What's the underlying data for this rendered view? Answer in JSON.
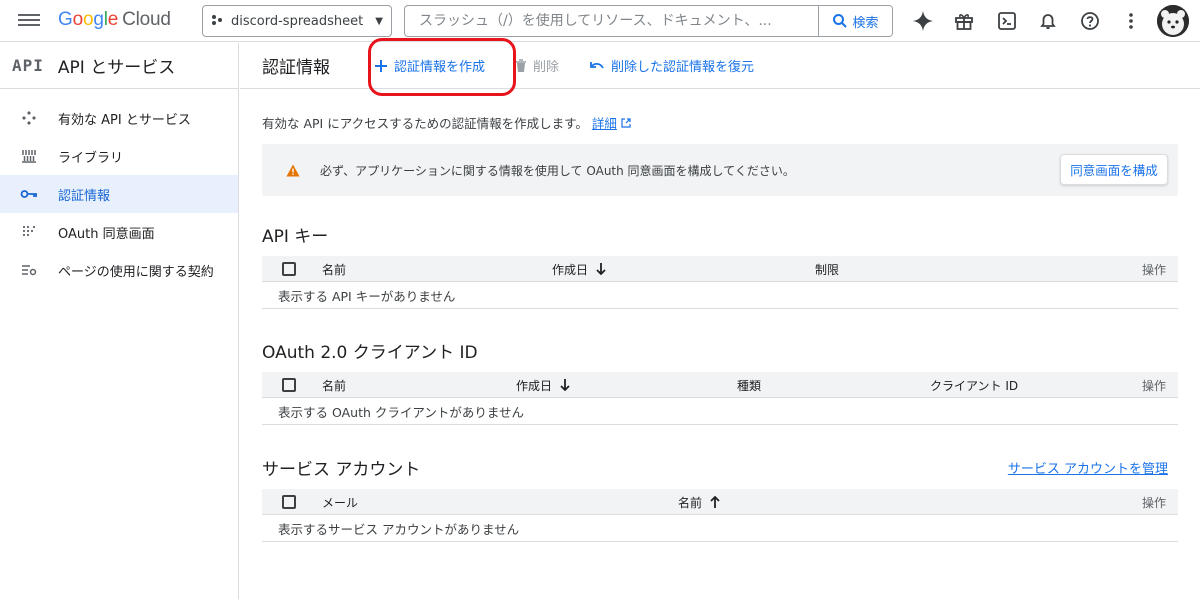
{
  "topbar": {
    "logo_letters": [
      "G",
      "o",
      "o",
      "g",
      "l",
      "e"
    ],
    "logo_cloud": "Cloud",
    "project_name": "discord-spreadsheet",
    "search_placeholder": "スラッシュ（/）を使用してリソース、ドキュメント、...",
    "search_button": "検索",
    "icons": [
      "gemini-icon",
      "gift-icon",
      "cloud-shell-icon",
      "bell-icon",
      "help-icon",
      "more-vert-icon"
    ]
  },
  "sidebar": {
    "badge": "API",
    "title": "API とサービス",
    "items": [
      {
        "label": "有効な API とサービス",
        "icon": "api-icon"
      },
      {
        "label": "ライブラリ",
        "icon": "library-icon"
      },
      {
        "label": "認証情報",
        "icon": "key-icon",
        "active": true
      },
      {
        "label": "OAuth 同意画面",
        "icon": "oauth-icon"
      },
      {
        "label": "ページの使用に関する契約",
        "icon": "settings-list-icon"
      }
    ]
  },
  "header": {
    "title": "認証情報",
    "create_label": "認証情報を作成",
    "delete_label": "削除",
    "restore_label": "削除した認証情報を復元"
  },
  "description": {
    "text": "有効な API にアクセスするための認証情報を作成します。",
    "link": "詳細"
  },
  "notice": {
    "text": "必ず、アプリケーションに関する情報を使用して OAuth 同意画面を構成してください。",
    "button": "同意画面を構成"
  },
  "api_keys": {
    "title": "API キー",
    "columns": [
      "名前",
      "作成日",
      "制限",
      "操作"
    ],
    "empty": "表示する API キーがありません"
  },
  "oauth": {
    "title": "OAuth 2.0 クライアント ID",
    "columns": [
      "名前",
      "作成日",
      "種類",
      "クライアント ID",
      "操作"
    ],
    "empty": "表示する OAuth クライアントがありません"
  },
  "service_accounts": {
    "title": "サービス アカウント",
    "manage_link": "サービス アカウントを管理",
    "columns": [
      "メール",
      "名前",
      "操作"
    ],
    "empty": "表示するサービス アカウントがありません"
  },
  "colors": {
    "accent": "#1a73e8",
    "highlight": "#e8141c",
    "warning": "#e37400"
  }
}
